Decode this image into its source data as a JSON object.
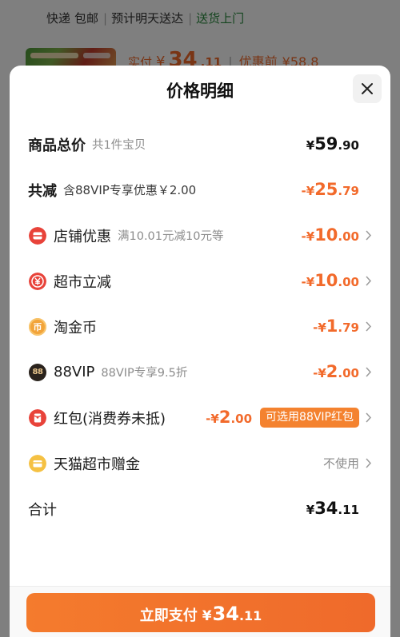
{
  "background_page": {
    "shipping": {
      "express": "快递",
      "free_shipping": "包邮",
      "separator": "|",
      "eta": "预计明天送达",
      "delivery": "送货上门"
    },
    "product": {
      "paid_label": "实付",
      "paid_currency": "¥",
      "paid_int": "34",
      "paid_dec": ".11",
      "separator": "|",
      "original_label": "优惠前",
      "original_price": "¥58.8"
    }
  },
  "sheet": {
    "title": "价格明细",
    "close_icon": "close-icon",
    "chevron_icon": "chevron-right-icon",
    "goods_total": {
      "label": "商品总价",
      "note": "共1件宝贝",
      "currency": "¥",
      "int": "59",
      "dec": ".90"
    },
    "total_reduction": {
      "label": "共减",
      "note": "含88VIP专享优惠￥2.00",
      "prefix": "-¥",
      "int": "25",
      "dec": ".79"
    },
    "discounts": [
      {
        "icon": "shop-coupon-icon",
        "label": "店铺优惠",
        "note": "满10.01元减10元等",
        "prefix": "-¥",
        "int": "10",
        "dec": ".00"
      },
      {
        "icon": "supermarket-discount-icon",
        "label": "超市立减",
        "prefix": "-¥",
        "int": "10",
        "dec": ".00"
      },
      {
        "icon": "taojinbi-coin-icon",
        "icon_text": "币",
        "label": "淘金币",
        "prefix": "-¥",
        "int": "1",
        "dec": ".79"
      },
      {
        "icon": "88vip-icon",
        "icon_text": "88",
        "label": "88VIP",
        "note": "88VIP专享9.5折",
        "prefix": "-¥",
        "int": "2",
        "dec": ".00"
      },
      {
        "icon": "red-packet-icon",
        "label": "红包(消费券未抵)",
        "prefix": "-¥",
        "int": "2",
        "dec": ".00",
        "badge": "可选用88VIP红包"
      },
      {
        "icon": "tmall-gift-card-icon",
        "label": "天猫超市赠金",
        "value": "不使用"
      }
    ],
    "total": {
      "label": "合计",
      "currency": "¥",
      "int": "34",
      "dec": ".11"
    }
  },
  "footer": {
    "pay_button": {
      "label": "立即支付",
      "currency": "¥",
      "int": "34",
      "dec": ".11"
    }
  },
  "colors": {
    "accent_orange": "#f26a2b",
    "badge_orange": "#f4822f",
    "pay_button": "#f47b2d",
    "delivery_green": "#2b8a3e",
    "muted_grey": "#8c8c8c",
    "text_dark": "#1a1a1a",
    "shop_icon_red": "#e8433a",
    "coin_gold": "#f2a43a",
    "gift_card_yellow": "#f5c143",
    "vip_dark": "#2a231d"
  }
}
